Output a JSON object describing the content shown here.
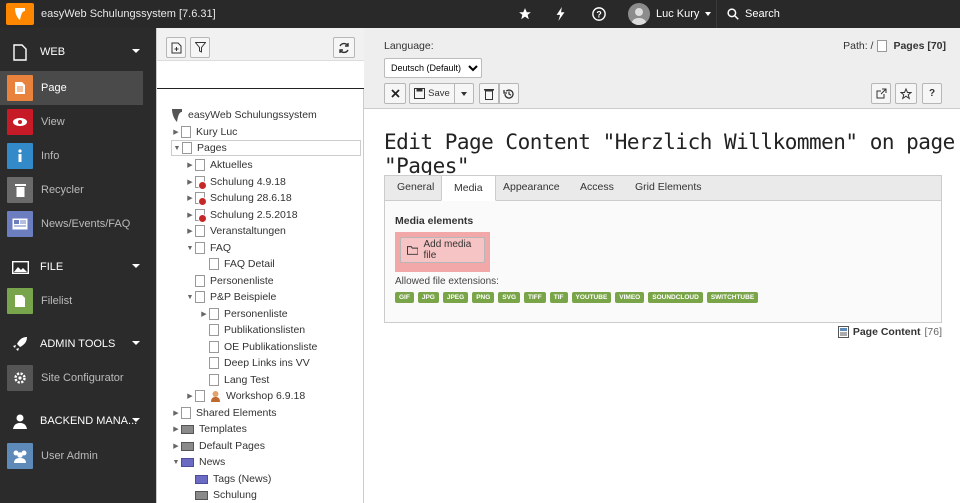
{
  "topbar": {
    "site_name": "easyWeb Schulungssystem [7.6.31]",
    "user_name": "Luc Kury",
    "search_label": "Search"
  },
  "modules": {
    "groups": [
      {
        "label": "WEB"
      },
      {
        "label": "FILE"
      },
      {
        "label": "ADMIN TOOLS"
      },
      {
        "label": "BACKEND MANA..."
      }
    ],
    "items": [
      {
        "label": "Page",
        "color": "#e9823c"
      },
      {
        "label": "View",
        "color": "#c61b26"
      },
      {
        "label": "Info",
        "color": "#338ac8"
      },
      {
        "label": "Recycler",
        "color": "#6a6a6a"
      },
      {
        "label": "News/Events/FAQ",
        "color": "#6d7ec0"
      },
      {
        "label": "Filelist",
        "color": "#78a54b"
      },
      {
        "label": "Site Configurator",
        "color": "#555555"
      },
      {
        "label": "User Admin",
        "color": "#5d8ab8"
      }
    ]
  },
  "tree": {
    "root": "easyWeb Schulungssystem",
    "nodes": [
      "Kury Luc",
      "Pages",
      "Aktuelles",
      "Schulung 4.9.18",
      "Schulung 28.6.18",
      "Schulung 2.5.2018",
      "Veranstaltungen",
      "FAQ",
      "FAQ Detail",
      "Personenliste",
      "P&P Beispiele",
      "Personenliste",
      "Publikationslisten",
      "OE Publikationsliste",
      "Deep Links ins VV",
      "Lang Test",
      "Workshop 6.9.18",
      "Shared Elements",
      "Templates",
      "Default Pages",
      "News",
      "Tags (News)",
      "Schulung"
    ]
  },
  "docheader": {
    "language_label": "Language:",
    "language_value": "Deutsch (Default)",
    "save_label": "Save",
    "path_label": "Path: /",
    "path_page": "Pages [70]"
  },
  "main": {
    "heading": "Edit Page Content \"Herzlich Willkommen\" on page \"Pages\"",
    "tabs": [
      "General",
      "Media",
      "Appearance",
      "Access",
      "Grid Elements"
    ],
    "active_tab": "Media",
    "section_title": "Media elements",
    "add_media_label": "Add media file",
    "allowed_label": "Allowed file extensions:",
    "extensions": [
      "GIF",
      "JPG",
      "JPEG",
      "PNG",
      "SVG",
      "TIFF",
      "TIF",
      "YOUTUBE",
      "VIMEO",
      "SOUNDCLOUD",
      "SWITCHTUBE"
    ],
    "record_type": "Page Content",
    "record_uid": "[76]"
  },
  "colors": {
    "accent": "#ff8700",
    "topbar": "#292929",
    "sidebar": "#2b2b2b",
    "highlight": "#f2a8a8",
    "ext_badge": "#79a548"
  }
}
